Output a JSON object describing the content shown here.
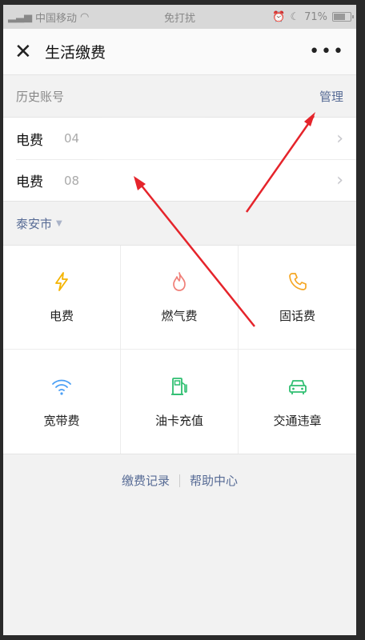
{
  "status_bar": {
    "carrier": "中国移动",
    "mode": "免打扰",
    "battery": "71%",
    "battery_level": 0.71
  },
  "nav": {
    "title": "生活缴费",
    "close_icon": "close-icon",
    "more_icon": "more-icon"
  },
  "history": {
    "label": "历史账号",
    "manage_label": "管理"
  },
  "accounts": [
    {
      "type": "电费",
      "number_visible": "04"
    },
    {
      "type": "电费",
      "number_visible": "08"
    }
  ],
  "city": {
    "name": "泰安市"
  },
  "services": [
    {
      "label": "电费",
      "icon": "lightning-icon",
      "color": "#f5b400"
    },
    {
      "label": "燃气费",
      "icon": "flame-icon",
      "color": "#f07f78"
    },
    {
      "label": "固话费",
      "icon": "phone-icon",
      "color": "#f5a623"
    },
    {
      "label": "宽带费",
      "icon": "wifi-icon",
      "color": "#4a9ff5"
    },
    {
      "label": "油卡充值",
      "icon": "fuel-pump-icon",
      "color": "#2fbf71"
    },
    {
      "label": "交通违章",
      "icon": "car-icon",
      "color": "#2fbf71"
    }
  ],
  "footer": {
    "records": "缴费记录",
    "help": "帮助中心"
  },
  "colors": {
    "link": "#576b95",
    "annotation_arrow": "#e5242b"
  }
}
